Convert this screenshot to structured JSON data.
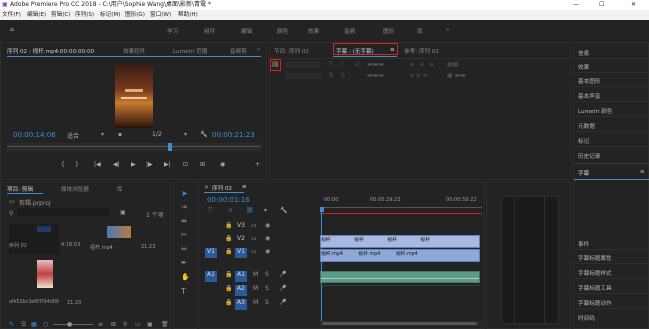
{
  "app": {
    "title": "Adobe Premiere Pro CC 2018 - C:\\用户\\Sophie Wang\\桌面\\影新\\青電 *",
    "win_controls": [
      "—",
      "☐",
      "✕"
    ]
  },
  "menu": [
    "文件(F)",
    "编辑(E)",
    "剪辑(C)",
    "序列(S)",
    "标记(M)",
    "图形(G)",
    "窗口(W)",
    "帮助(H)"
  ],
  "workspaces": [
    "学习",
    "组件",
    "编辑",
    "颜色",
    "效果",
    "音频",
    "图形",
    "库"
  ],
  "source_monitor": {
    "tabs": [
      "序列 02 : 视杆.mp4:00:00:00:00",
      "效果控件",
      "Lumetri 范围",
      "音频剪"
    ],
    "timecode": "00:00:14:06",
    "fit": "适合",
    "ratio": "1/2",
    "duration": "00:00:21:23"
  },
  "program_panel": {
    "tabs": [
      "节目: 序列 02",
      "字幕 : (无字幕)",
      "参考: 序列 02"
    ],
    "menu_glyph": "≡"
  },
  "right_panel": {
    "items": [
      "信息",
      "效果",
      "基本图形",
      "基本声音",
      "Lumetri 颜色",
      "元数据",
      "标记",
      "历史记录"
    ],
    "section": "字幕",
    "menu_glyph": "≡",
    "lower_items": [
      "事件",
      "字幕标题属性",
      "字幕标题样式",
      "字幕标题工具",
      "字幕标题动作",
      "时间码"
    ]
  },
  "project": {
    "tabs": [
      "项目: 剪辑",
      "媒体浏览器",
      "库"
    ],
    "file": "剪辑.prproj",
    "count": "1 个项",
    "items": [
      {
        "name": "序列 02",
        "dur": "4:18:03"
      },
      {
        "name": "视杆.mp4",
        "dur": "21:23"
      },
      {
        "name": "afk52bc3e6f7f94d09",
        "dur": "21:20"
      }
    ]
  },
  "timeline": {
    "tab": "序列 02",
    "timecode": "00:00:01:16",
    "ruler": [
      "00:00",
      "00:00:29:23",
      "00:00:59:22"
    ],
    "tracks": {
      "video": [
        "V3",
        "V2",
        "V1"
      ],
      "audio": [
        "A1",
        "A2",
        "A3"
      ]
    },
    "clip_label": "视杆",
    "clip_file": "视杆.mp4"
  }
}
